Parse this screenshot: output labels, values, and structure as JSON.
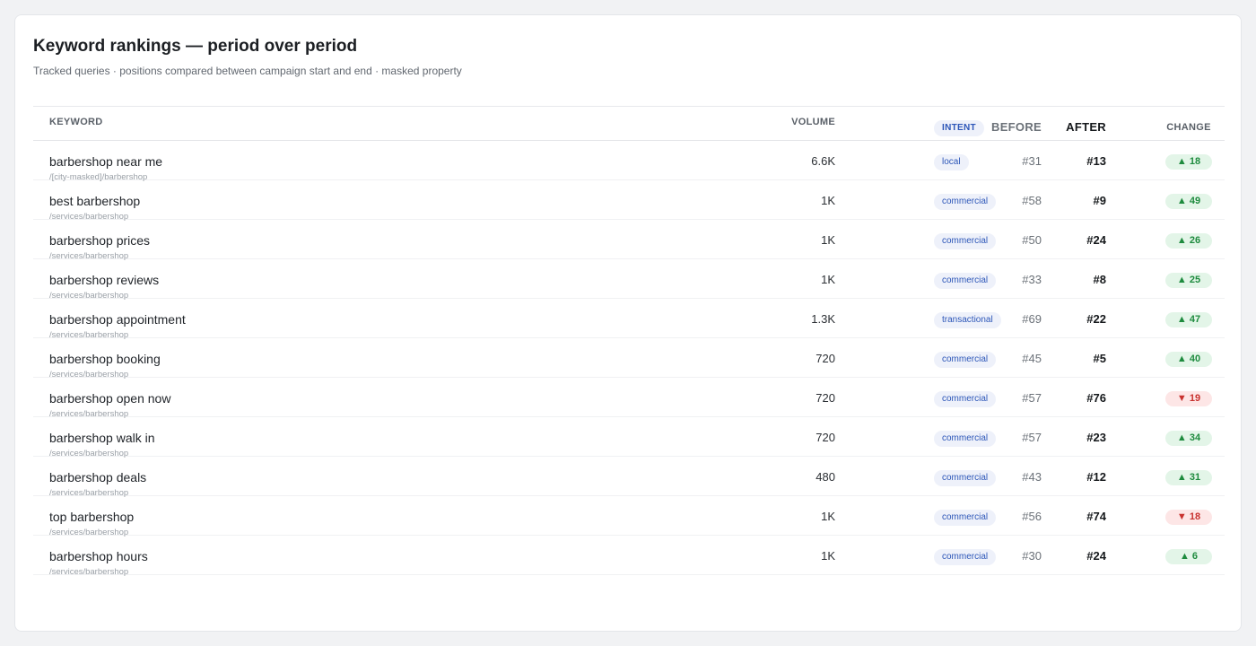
{
  "header": {
    "title": "Keyword rankings — period over period",
    "subtitle": "Tracked queries · positions compared between campaign start and end · masked property"
  },
  "table": {
    "columns": {
      "keyword": "KEYWORD",
      "volume": "VOLUME",
      "intent": "INTENT",
      "before": "BEFORE",
      "after": "AFTER",
      "change": "CHANGE"
    },
    "rows": [
      {
        "keyword": "barbershop near me",
        "path": "/[city-masked]/barbershop",
        "volume": "6.6K",
        "intent": "local",
        "before": "#31",
        "after": "#13",
        "change": "▲ 18",
        "direction": "up"
      },
      {
        "keyword": "best barbershop",
        "path": "/services/barbershop",
        "volume": "1K",
        "intent": "commercial",
        "before": "#58",
        "after": "#9",
        "change": "▲ 49",
        "direction": "up"
      },
      {
        "keyword": "barbershop prices",
        "path": "/services/barbershop",
        "volume": "1K",
        "intent": "commercial",
        "before": "#50",
        "after": "#24",
        "change": "▲ 26",
        "direction": "up"
      },
      {
        "keyword": "barbershop reviews",
        "path": "/services/barbershop",
        "volume": "1K",
        "intent": "commercial",
        "before": "#33",
        "after": "#8",
        "change": "▲ 25",
        "direction": "up"
      },
      {
        "keyword": "barbershop appointment",
        "path": "/services/barbershop",
        "volume": "1.3K",
        "intent": "transactional",
        "before": "#69",
        "after": "#22",
        "change": "▲ 47",
        "direction": "up"
      },
      {
        "keyword": "barbershop booking",
        "path": "/services/barbershop",
        "volume": "720",
        "intent": "commercial",
        "before": "#45",
        "after": "#5",
        "change": "▲ 40",
        "direction": "up"
      },
      {
        "keyword": "barbershop open now",
        "path": "/services/barbershop",
        "volume": "720",
        "intent": "commercial",
        "before": "#57",
        "after": "#76",
        "change": "▼ 19",
        "direction": "down"
      },
      {
        "keyword": "barbershop walk in",
        "path": "/services/barbershop",
        "volume": "720",
        "intent": "commercial",
        "before": "#57",
        "after": "#23",
        "change": "▲ 34",
        "direction": "up"
      },
      {
        "keyword": "barbershop deals",
        "path": "/services/barbershop",
        "volume": "480",
        "intent": "commercial",
        "before": "#43",
        "after": "#12",
        "change": "▲ 31",
        "direction": "up"
      },
      {
        "keyword": "top barbershop",
        "path": "/services/barbershop",
        "volume": "1K",
        "intent": "commercial",
        "before": "#56",
        "after": "#74",
        "change": "▼ 18",
        "direction": "down"
      },
      {
        "keyword": "barbershop hours",
        "path": "/services/barbershop",
        "volume": "1K",
        "intent": "commercial",
        "before": "#30",
        "after": "#24",
        "change": "▲ 6",
        "direction": "up"
      }
    ]
  },
  "colors": {
    "up_bg": "#e3f5e8",
    "up_text": "#1e8b3e",
    "down_bg": "#fde6e6",
    "down_text": "#c8322f",
    "intent_bg": "#eef1fa",
    "intent_text": "#2c56b8"
  }
}
